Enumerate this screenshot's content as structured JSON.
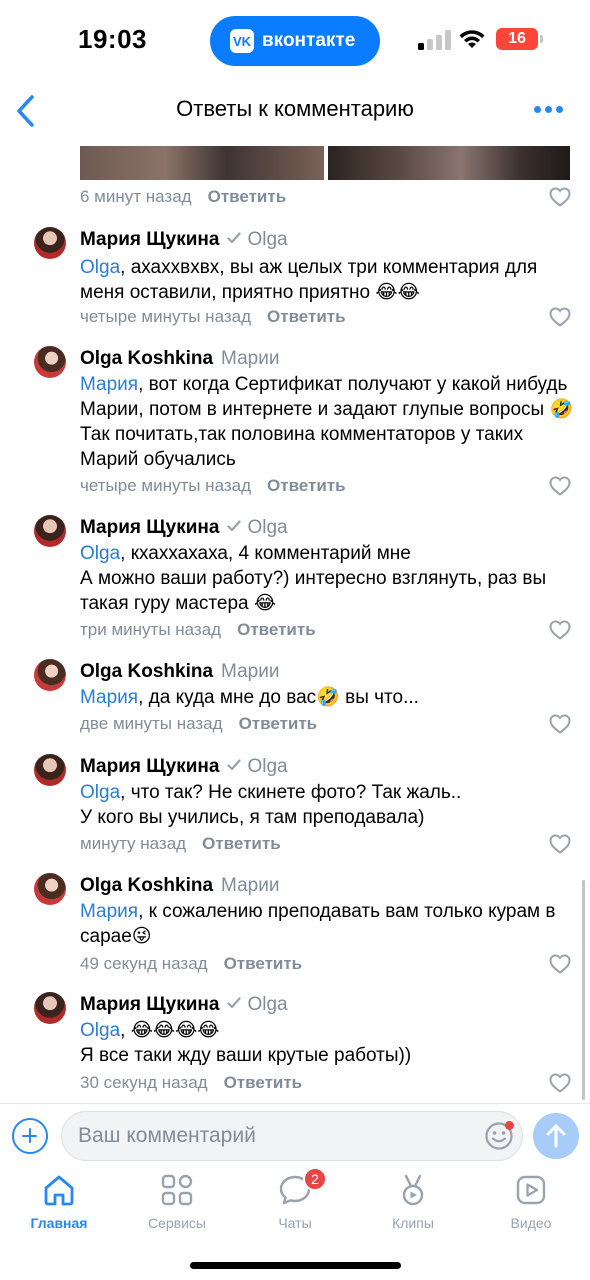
{
  "status_bar": {
    "time": "19:03",
    "vk_logo": "VK",
    "vk_app_label": "вконтакте",
    "battery": "16"
  },
  "header": {
    "title": "Ответы к комментарию"
  },
  "top_comment_meta": {
    "time": "6 минут назад",
    "reply_label": "Ответить"
  },
  "comments": [
    {
      "author": "Мария Щукина",
      "verified": true,
      "reply_to": "Olga",
      "mention": "Olga",
      "text": ", ахаххвхвх, вы аж целых три комментария для меня оставили, приятно приятно 😂😂",
      "time": "четыре минуты назад",
      "reply_label": "Ответить"
    },
    {
      "author": "Olga Koshkina",
      "verified": false,
      "reply_to": "Марии",
      "mention": "Мария",
      "text": ", вот когда Сертификат получают у какой нибудь Марии, потом в интернете и задают глупые вопросы 🤣Так почитать,так половина комментаторов у таких Марий обучались",
      "time": "четыре минуты назад",
      "reply_label": "Ответить"
    },
    {
      "author": "Мария Щукина",
      "verified": true,
      "reply_to": "Olga",
      "mention": "Olga",
      "text": ", кхаххахаха, 4 комментарий мне",
      "text2": "А можно ваши работу?) интересно взглянуть, раз вы такая гуру мастера 😂",
      "time": "три минуты назад",
      "reply_label": "Ответить"
    },
    {
      "author": "Olga Koshkina",
      "verified": false,
      "reply_to": "Марии",
      "mention": "Мария",
      "text": ", да куда мне до вас🤣 вы что...",
      "time": "две минуты назад",
      "reply_label": "Ответить"
    },
    {
      "author": "Мария Щукина",
      "verified": true,
      "reply_to": "Olga",
      "mention": "Olga",
      "text": ", что так? Не скинете фото? Так жаль..",
      "text2": "У кого вы учились, я там преподавала)",
      "time": "минуту назад",
      "reply_label": "Ответить"
    },
    {
      "author": "Olga Koshkina",
      "verified": false,
      "reply_to": "Марии",
      "mention": "Мария",
      "text": ", к сожалению преподавать вам только курам в сарае😜",
      "time": "49 секунд назад",
      "reply_label": "Ответить"
    },
    {
      "author": "Мария Щукина",
      "verified": true,
      "reply_to": "Olga",
      "mention": "Olga",
      "text": ", 😂😂😂😂",
      "text2": "Я все таки жду ваши крутые работы))",
      "time": "30 секунд назад",
      "reply_label": "Ответить"
    }
  ],
  "composer": {
    "placeholder": "Ваш комментарий"
  },
  "tabbar": {
    "items": [
      {
        "label": "Главная",
        "icon": "home-icon",
        "active": true
      },
      {
        "label": "Сервисы",
        "icon": "services-icon",
        "active": false
      },
      {
        "label": "Чаты",
        "icon": "chat-icon",
        "active": false,
        "badge": "2"
      },
      {
        "label": "Клипы",
        "icon": "clips-icon",
        "active": false
      },
      {
        "label": "Видео",
        "icon": "video-icon",
        "active": false
      }
    ]
  },
  "colors": {
    "accent": "#2787f5",
    "vk_blue": "#0a7cff",
    "secondary_text": "#818c99",
    "mention": "#2a7dd6",
    "badge": "#e64646"
  }
}
